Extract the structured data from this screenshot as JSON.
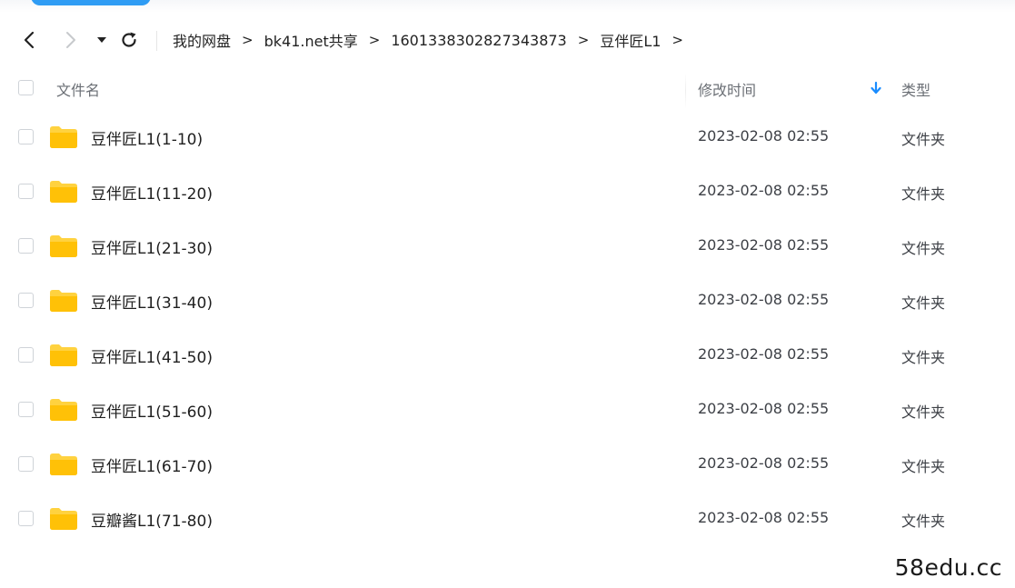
{
  "nav": {
    "icons": {
      "back": "chevron-left-icon",
      "forward": "chevron-right-icon",
      "history": "caret-down-icon",
      "refresh": "refresh-icon"
    },
    "breadcrumb": [
      {
        "label": "我的网盘"
      },
      {
        "label": "bk41.net共享"
      },
      {
        "label": "1601338302827343873"
      },
      {
        "label": "豆伴匠L1"
      }
    ],
    "separator": ">"
  },
  "header": {
    "name": "文件名",
    "time": "修改时间",
    "type": "类型",
    "sort_icon": "arrow-down-icon",
    "sort_color": "#1a8cff"
  },
  "rows": [
    {
      "name": "豆伴匠L1(1-10)",
      "time": "2023-02-08 02:55",
      "type": "文件夹"
    },
    {
      "name": "豆伴匠L1(11-20)",
      "time": "2023-02-08 02:55",
      "type": "文件夹"
    },
    {
      "name": "豆伴匠L1(21-30)",
      "time": "2023-02-08 02:55",
      "type": "文件夹"
    },
    {
      "name": "豆伴匠L1(31-40)",
      "time": "2023-02-08 02:55",
      "type": "文件夹"
    },
    {
      "name": "豆伴匠L1(41-50)",
      "time": "2023-02-08 02:55",
      "type": "文件夹"
    },
    {
      "name": "豆伴匠L1(51-60)",
      "time": "2023-02-08 02:55",
      "type": "文件夹"
    },
    {
      "name": "豆伴匠L1(61-70)",
      "time": "2023-02-08 02:55",
      "type": "文件夹"
    },
    {
      "name": "豆瓣酱L1(71-80)",
      "time": "2023-02-08 02:55",
      "type": "文件夹"
    }
  ],
  "colors": {
    "folder": "#ffd23f",
    "accent": "#2f9cf4"
  },
  "watermark": "58edu.cc"
}
